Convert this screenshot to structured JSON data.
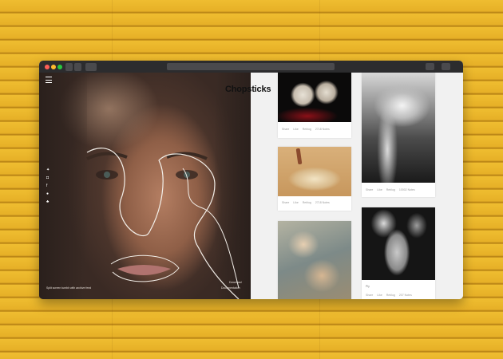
{
  "browser": {
    "controls": [
      "close",
      "minimize",
      "zoom"
    ]
  },
  "left_panel": {
    "social_icons": [
      "twitter-icon",
      "instagram-icon",
      "facebook-icon",
      "github-icon",
      "snapchat-icon"
    ],
    "caption": "Split screen tumblr with archive feed",
    "links": [
      "Download",
      "Documentation"
    ]
  },
  "brand": "Chopsticks",
  "cards": [
    {
      "image": "skulls-photo",
      "meta": [
        "Share",
        "Like",
        "Reblog",
        "2718 Notes"
      ]
    },
    {
      "image": "sand-arm-photo",
      "meta": [
        "Share",
        "Like",
        "Reblog",
        "2718 Notes"
      ]
    },
    {
      "image": "painting-photo",
      "meta": []
    },
    {
      "image": "tears-photo",
      "meta": [
        "Share",
        "Like",
        "Reblog",
        "10002 Notes"
      ]
    },
    {
      "image": "masks-photo",
      "title": "Ply",
      "meta": [
        "Share",
        "Like",
        "Reblog",
        "207 Notes"
      ]
    }
  ],
  "colors": {
    "background_wood": "#e9b52a",
    "titlebar": "#2c2c2e",
    "feed_bg": "#f1f1f1"
  }
}
